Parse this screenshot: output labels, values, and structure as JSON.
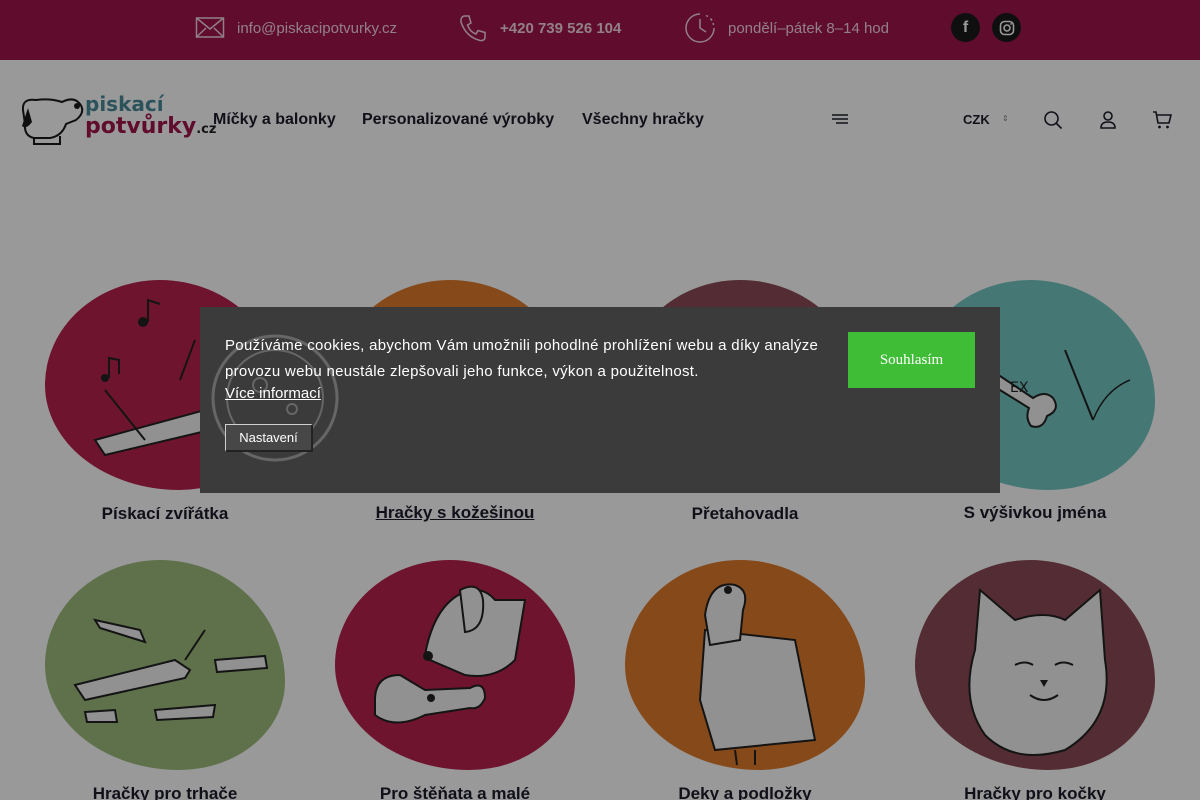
{
  "topbar": {
    "email": "info@piskacipotvurky.cz",
    "phone": "+420 739 526 104",
    "hours": "pondělí–pátek 8–14 hod",
    "social": [
      "facebook-icon",
      "instagram-icon"
    ]
  },
  "header": {
    "logo_line1": "piskací",
    "logo_line2": "potvůrky",
    "logo_suffix": ".cz",
    "nav": [
      "Míčky a balonky",
      "Personalizované výrobky",
      "Všechny hračky"
    ],
    "currency": "CZK",
    "icons": [
      "menu-icon",
      "search-icon",
      "user-icon",
      "cart-icon"
    ]
  },
  "categories": [
    {
      "label": "Pískací zvířátka",
      "color": "#b7224e"
    },
    {
      "label": "Hračky s kožešinou",
      "color": "#e07a2a"
    },
    {
      "label": "Přetahovadla",
      "color": "#8a4b55"
    },
    {
      "label": "S výšivkou jména",
      "color": "#74c7c2"
    },
    {
      "label": "Hračky pro trhače",
      "color": "#9fbc7e"
    },
    {
      "label": "Pro štěňata a malé",
      "color": "#b7224e"
    },
    {
      "label": "Deky a podložky",
      "color": "#e07a2a"
    },
    {
      "label": "Hračky pro kočky",
      "color": "#8a4b55"
    }
  ],
  "cookie": {
    "text": "Používáme cookies, abychom Vám umožnili pohodlné prohlížení webu a díky analýze provozu webu neustále zlepšovali jeho funkce, výkon a použitelnost.",
    "more": "Více informací",
    "settings": "Nastavení",
    "accept": "Souhlasím"
  },
  "colors": {
    "brand": "#a0144a",
    "accept": "#3fbd37",
    "dialog": "#3b3b3b"
  }
}
